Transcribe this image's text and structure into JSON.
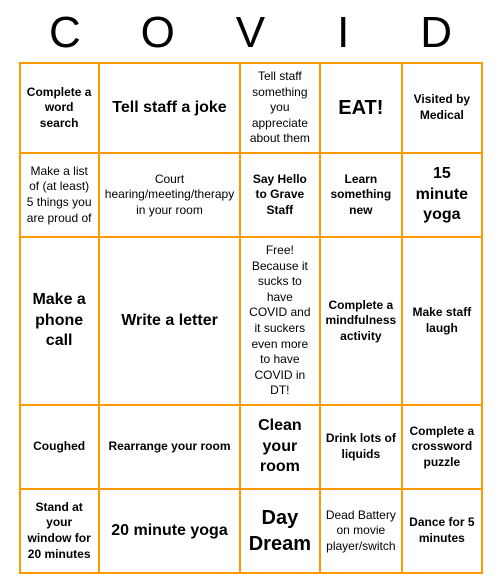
{
  "header": {
    "letters": [
      "C",
      "O",
      "V",
      "I",
      "D"
    ]
  },
  "cells": [
    {
      "text": "Complete a word search",
      "style": "bold"
    },
    {
      "text": "Tell staff a joke",
      "style": "medium-text"
    },
    {
      "text": "Tell staff something you appreciate about them",
      "style": "small"
    },
    {
      "text": "EAT!",
      "style": "large-text"
    },
    {
      "text": "Visited by Medical",
      "style": "bold"
    },
    {
      "text": "Make a list of (at least) 5 things you are proud of",
      "style": "small"
    },
    {
      "text": "Court hearing/meeting/therapy in your room",
      "style": "small"
    },
    {
      "text": "Say Hello to Grave Staff",
      "style": "bold"
    },
    {
      "text": "Learn something new",
      "style": "bold"
    },
    {
      "text": "15 minute yoga",
      "style": "medium-text"
    },
    {
      "text": "Make a phone call",
      "style": "medium-text"
    },
    {
      "text": "Write a letter",
      "style": "medium-text"
    },
    {
      "text": "Free! Because it sucks to have COVID and it suckers even more to have COVID in DT!",
      "style": "small"
    },
    {
      "text": "Complete a mindfulness activity",
      "style": "bold"
    },
    {
      "text": "Make staff laugh",
      "style": "bold"
    },
    {
      "text": "Coughed",
      "style": "bold"
    },
    {
      "text": "Rearrange your room",
      "style": "bold"
    },
    {
      "text": "Clean your room",
      "style": "medium-text"
    },
    {
      "text": "Drink lots of liquids",
      "style": "bold"
    },
    {
      "text": "Complete a crossword puzzle",
      "style": "bold"
    },
    {
      "text": "Stand at your window for 20 minutes",
      "style": "bold"
    },
    {
      "text": "20 minute yoga",
      "style": "medium-text"
    },
    {
      "text": "Day Dream",
      "style": "large-text"
    },
    {
      "text": "Dead Battery on movie player/switch",
      "style": "small"
    },
    {
      "text": "Dance for 5 minutes",
      "style": "bold"
    }
  ]
}
